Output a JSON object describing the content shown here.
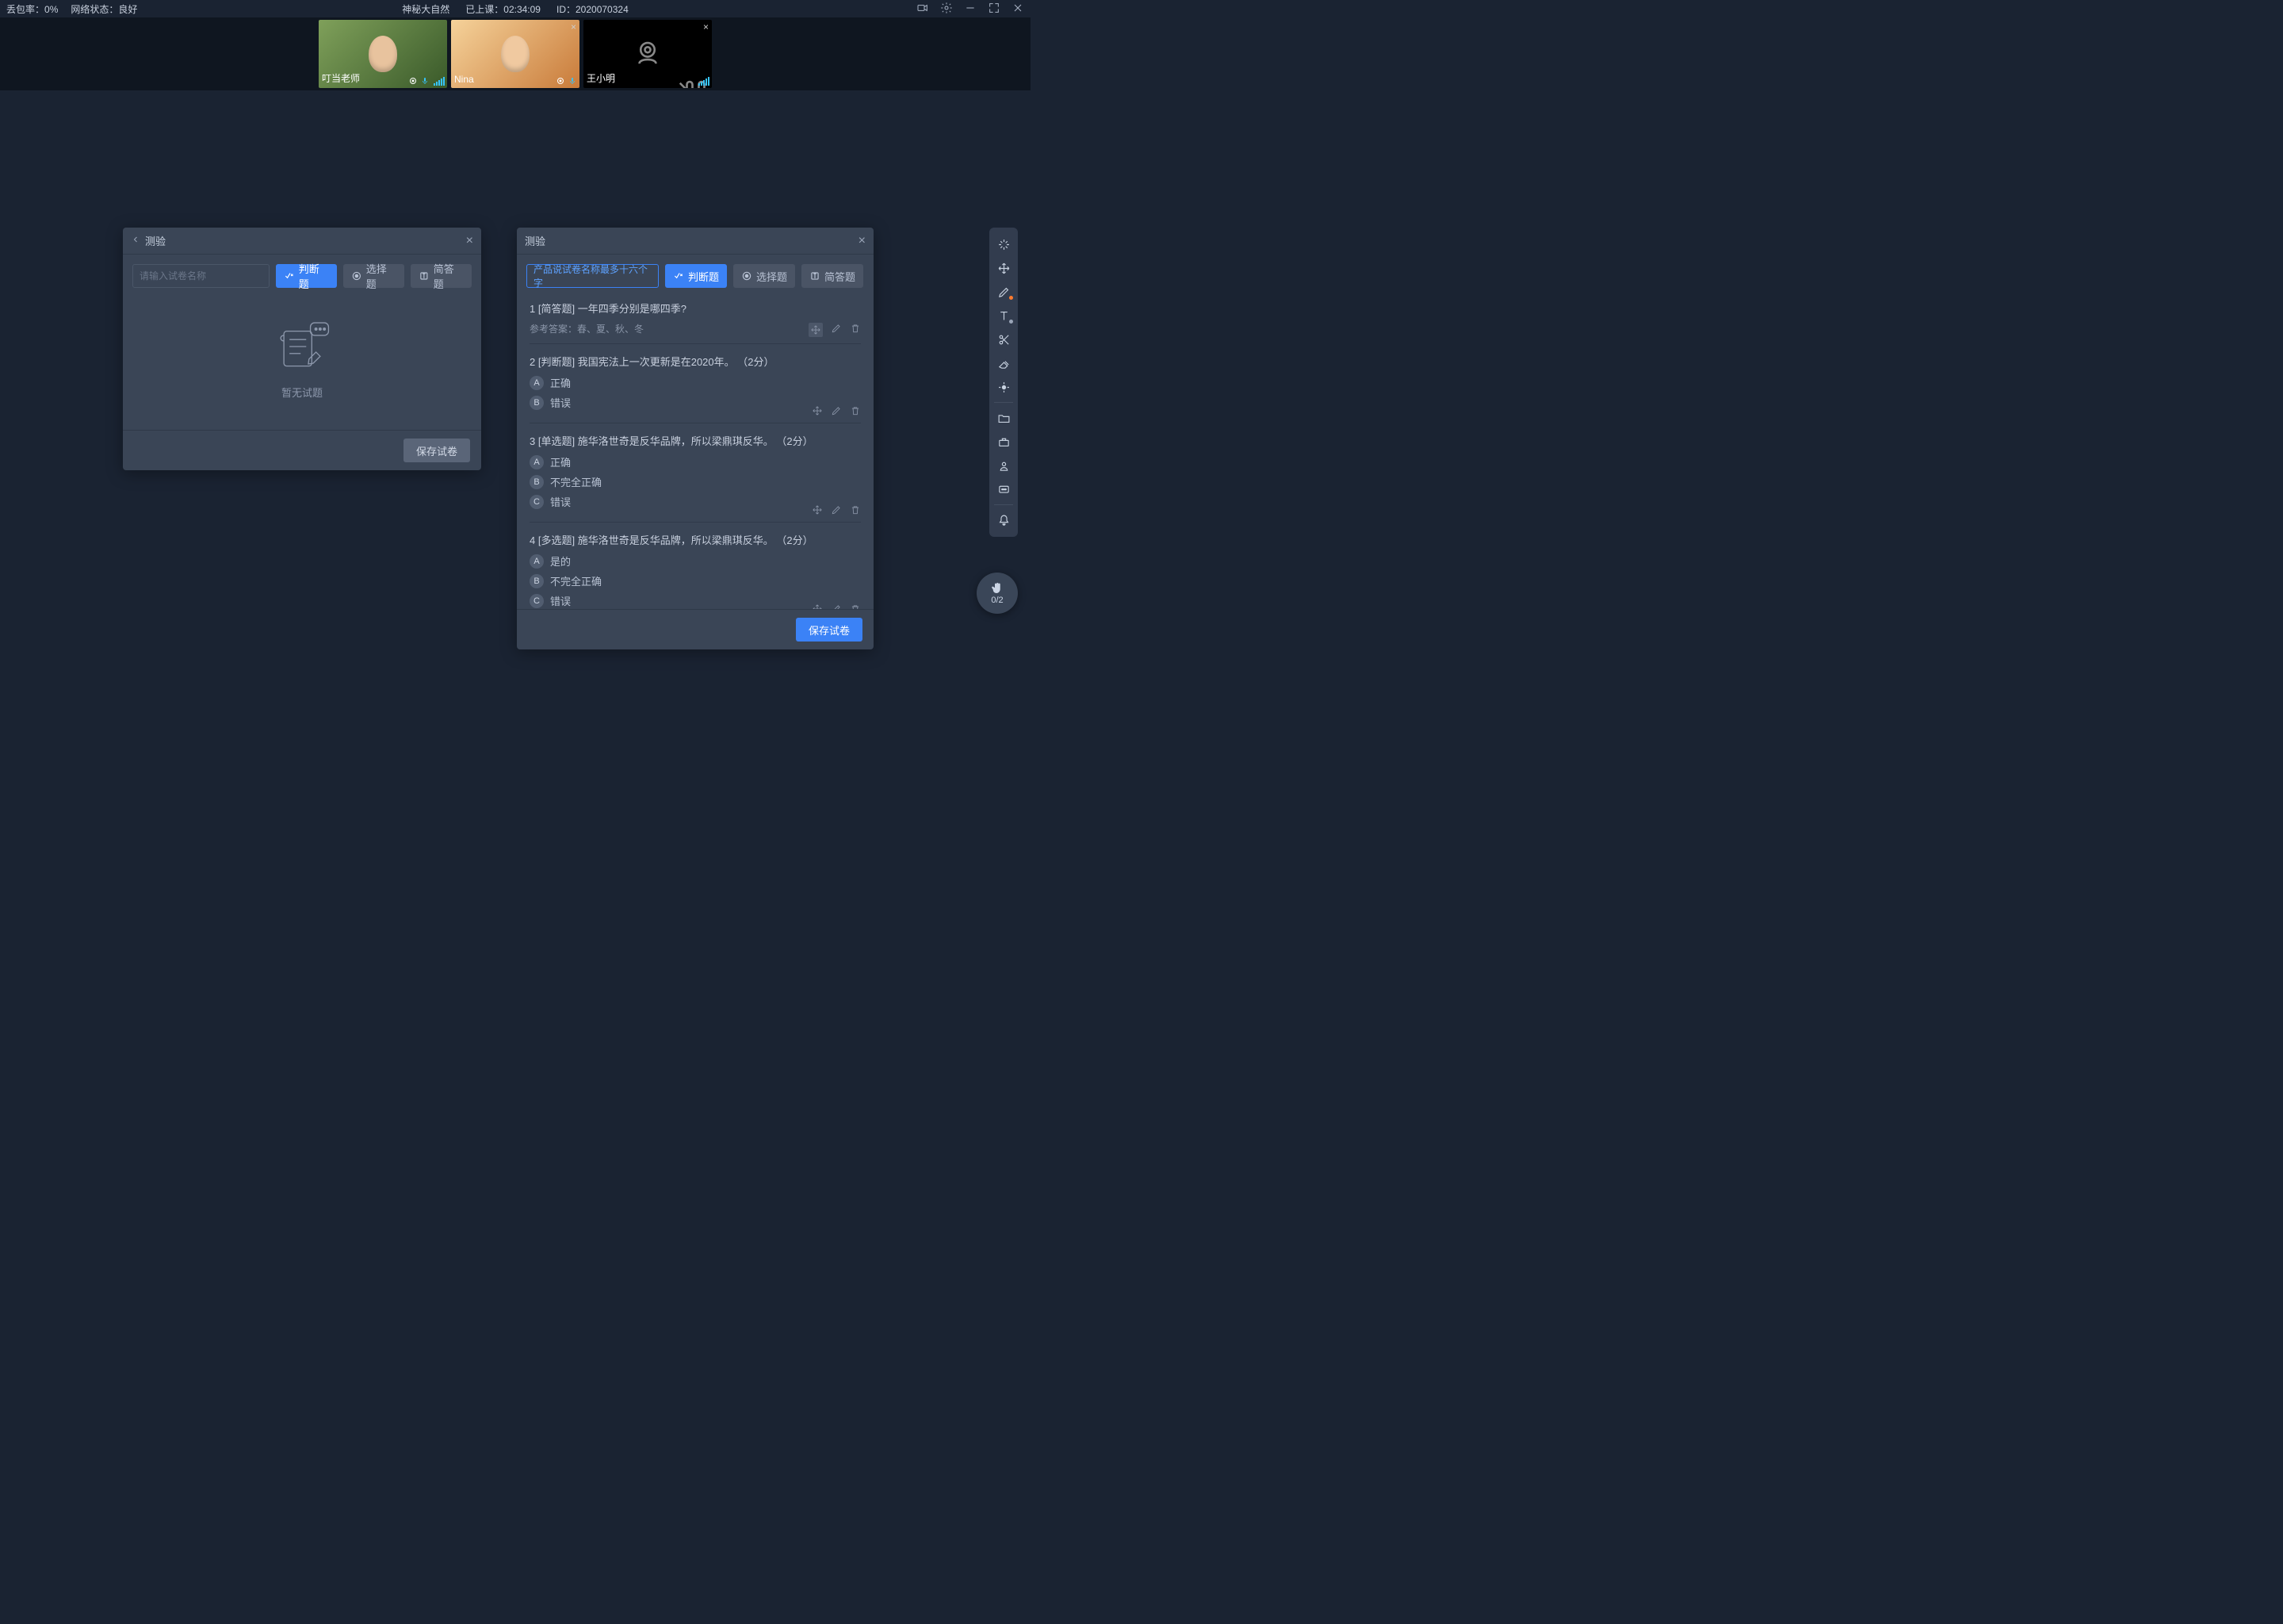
{
  "status": {
    "packet_loss_label": "丢包率：",
    "packet_loss_value": "0%",
    "network_label": "网络状态：",
    "network_value": "良好",
    "course_title": "神秘大自然",
    "elapsed_label": "已上课：",
    "elapsed_value": "02:34:09",
    "id_label": "ID：",
    "id_value": "2020070324"
  },
  "participants": [
    {
      "name": "叮当老师",
      "camera": true,
      "closeable": false
    },
    {
      "name": "Nina",
      "camera": true,
      "closeable": true
    },
    {
      "name": "王小明",
      "camera": false,
      "closeable": true
    }
  ],
  "panel_left": {
    "title": "测验",
    "placeholder": "请输入试卷名称",
    "tabs": {
      "judge": "判断题",
      "choice": "选择题",
      "short": "简答题"
    },
    "empty_text": "暂无试题",
    "save_btn": "保存试卷"
  },
  "panel_right": {
    "title": "测验",
    "name_value": "产品说试卷名称最多十六个字",
    "tabs": {
      "judge": "判断题",
      "choice": "选择题",
      "short": "简答题"
    },
    "save_btn": "保存试卷",
    "questions": [
      {
        "no": "1",
        "type_tag": "[简答题]",
        "text": "一年四季分别是哪四季?",
        "reference_label": "参考答案：",
        "reference": "春、夏、秋、冬",
        "options": []
      },
      {
        "no": "2",
        "type_tag": "[判断题]",
        "text": "我国宪法上一次更新是在2020年。",
        "score": "（2分）",
        "options": [
          {
            "k": "A",
            "v": "正确"
          },
          {
            "k": "B",
            "v": "错误"
          }
        ]
      },
      {
        "no": "3",
        "type_tag": "[单选题]",
        "text": "施华洛世奇是反华品牌，所以梁鼎琪反华。",
        "score": "（2分）",
        "options": [
          {
            "k": "A",
            "v": "正确"
          },
          {
            "k": "B",
            "v": "不完全正确"
          },
          {
            "k": "C",
            "v": "错误"
          }
        ]
      },
      {
        "no": "4",
        "type_tag": "[多选题]",
        "text": "施华洛世奇是反华品牌，所以梁鼎琪反华。",
        "score": "（2分）",
        "options": [
          {
            "k": "A",
            "v": "是的"
          },
          {
            "k": "B",
            "v": "不完全正确"
          },
          {
            "k": "C",
            "v": "错误"
          }
        ]
      }
    ]
  },
  "hand": {
    "count": "0/2"
  },
  "colors": {
    "accent": "#3b82f6"
  }
}
